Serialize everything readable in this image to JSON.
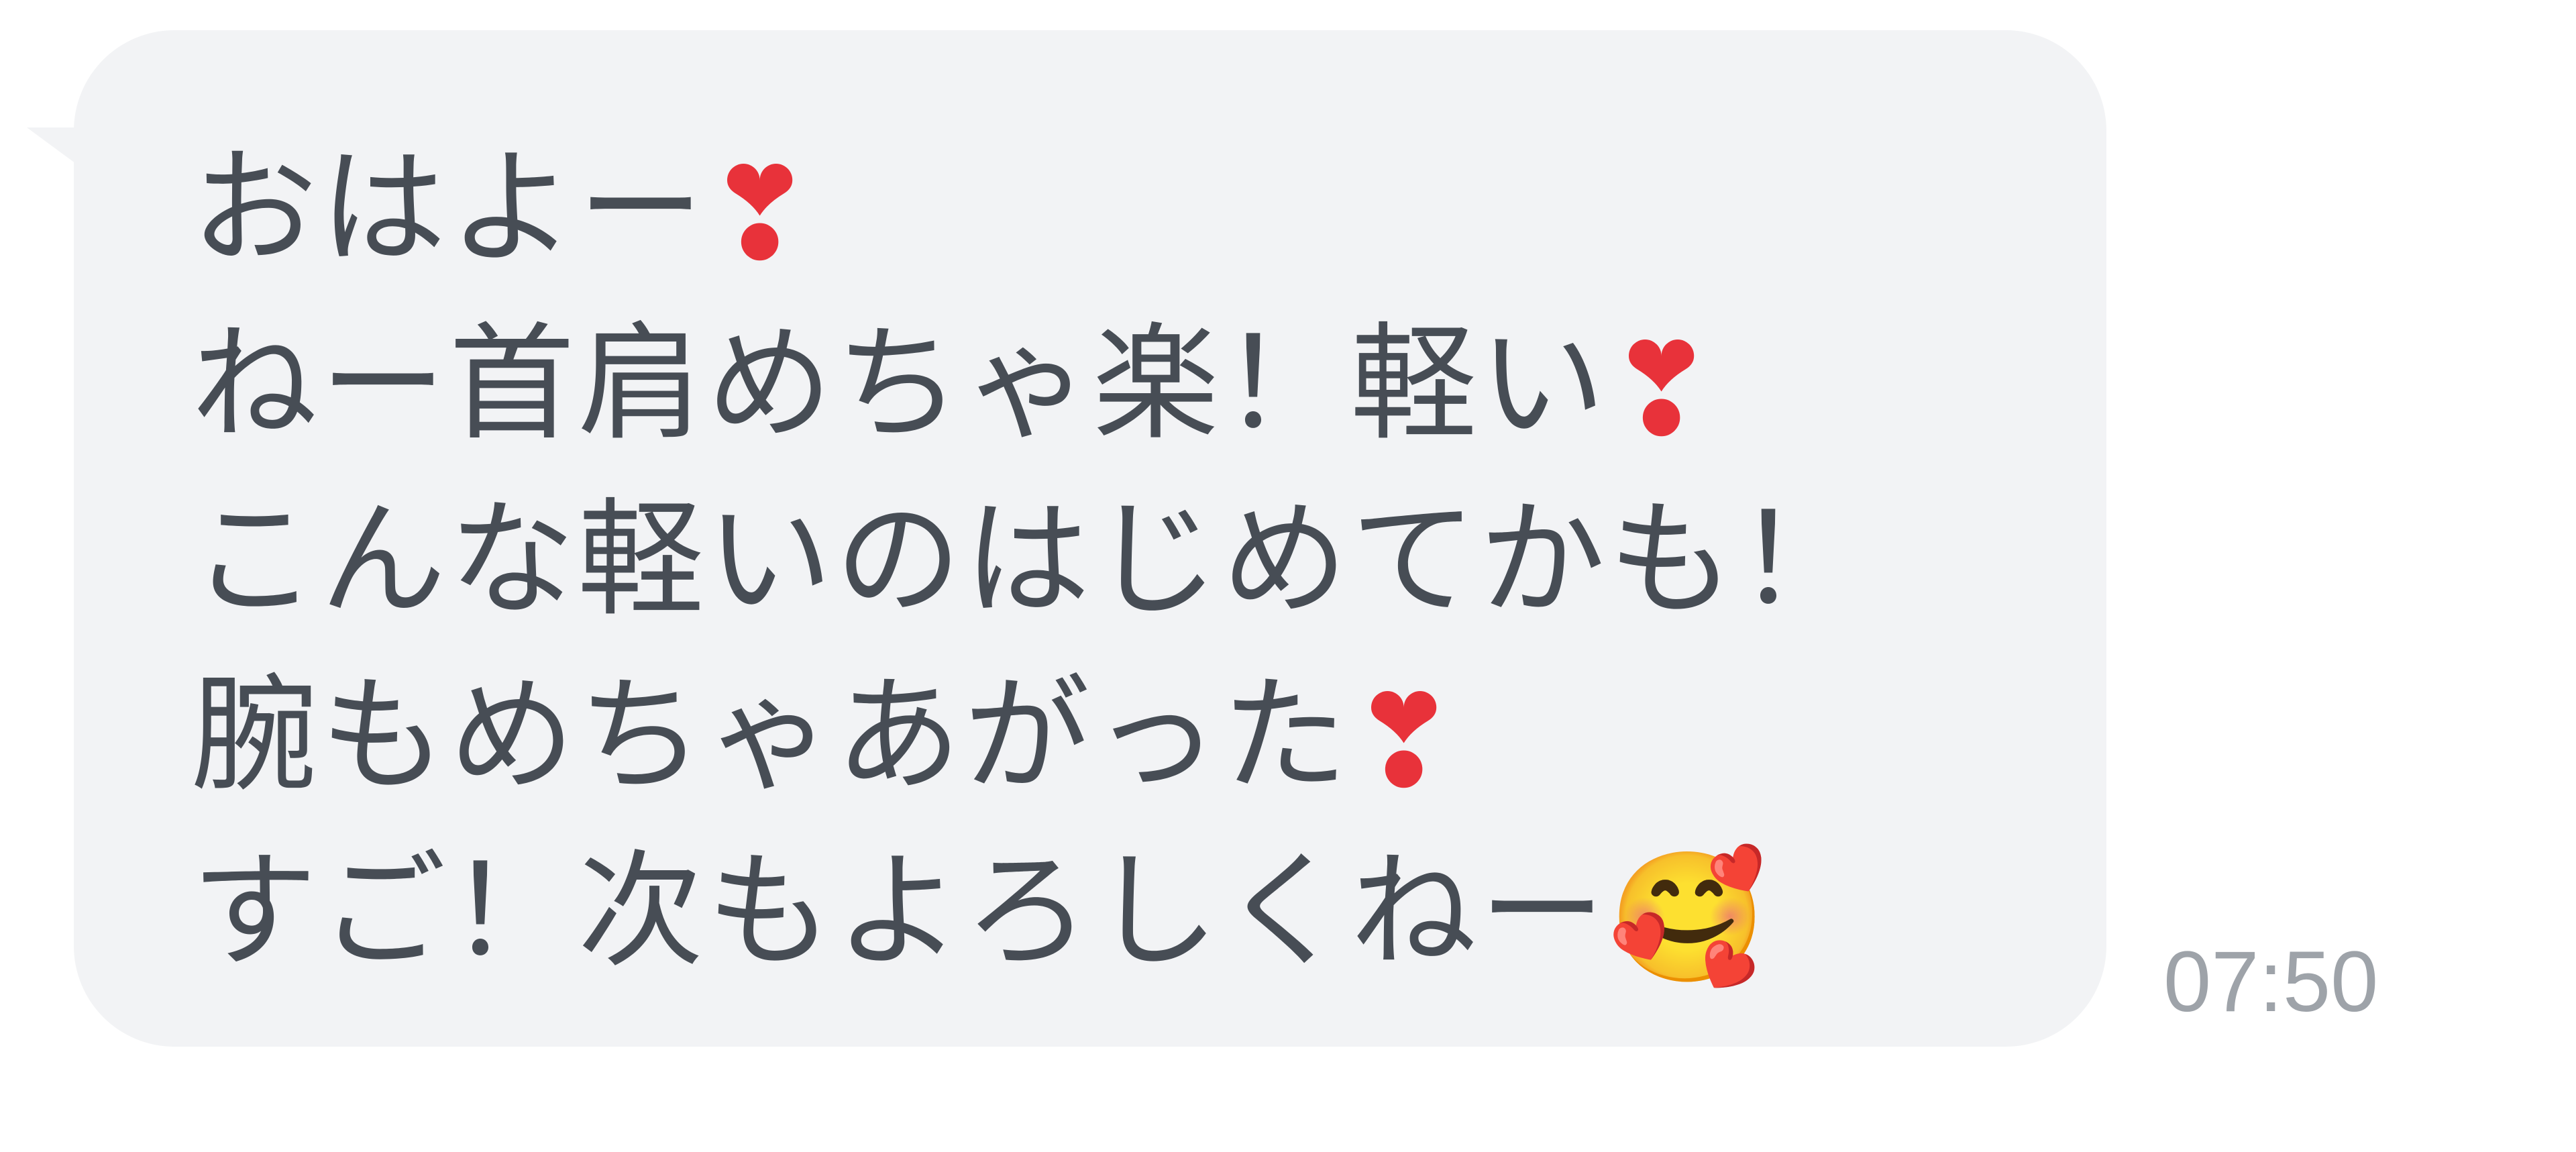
{
  "message": {
    "lines": [
      {
        "text": "おはよー",
        "emoji": "❣"
      },
      {
        "text": "ねー首肩めちゃ楽！軽い",
        "emoji": "❣"
      },
      {
        "text": "こんな軽いのはじめてかも！",
        "emoji": ""
      },
      {
        "text": "腕もめちゃあがった",
        "emoji": "❣"
      },
      {
        "text": "すご！次もよろしくねー",
        "emoji": "🥰"
      }
    ],
    "timestamp": "07:50"
  },
  "icons": {
    "line1": "heart-exclamation-icon",
    "line2": "heart-exclamation-icon",
    "line4": "heart-exclamation-icon",
    "line5": "smiling-face-with-hearts-icon"
  },
  "colors": {
    "bubble": "#f2f3f5",
    "text": "#474d55",
    "heart": "#e8323a",
    "timestamp": "#9ea3a9"
  }
}
